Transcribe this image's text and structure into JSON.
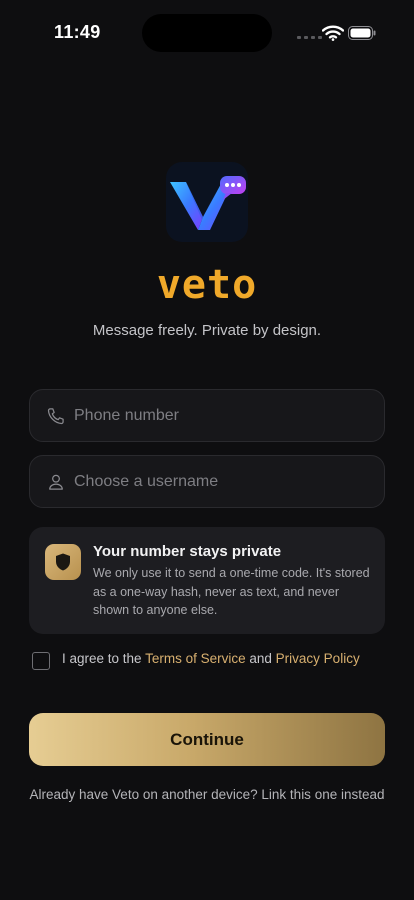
{
  "status_bar": {
    "time": "11:49"
  },
  "app": {
    "name": "veto",
    "tagline": "Message freely. Private by design.",
    "logo_icon": "veto-logo-icon",
    "accent_color": "#f0a92a"
  },
  "form": {
    "phone": {
      "placeholder": "Phone number",
      "value": "",
      "icon": "phone-icon"
    },
    "username": {
      "placeholder": "Choose a username",
      "value": "",
      "icon": "user-icon"
    }
  },
  "privacy": {
    "icon": "shield-icon",
    "title": "Your number stays private",
    "body": "We only use it to send a one-time code. It's stored as a one-way hash, never as text, and never shown to anyone else."
  },
  "terms": {
    "checked": false,
    "prefix": "I agree to the",
    "tos": "Terms of Service",
    "and": "and",
    "privacy_policy": "Privacy Policy"
  },
  "continue_label": "Continue",
  "link_device": "Already have Veto on another device? Link this one instead"
}
